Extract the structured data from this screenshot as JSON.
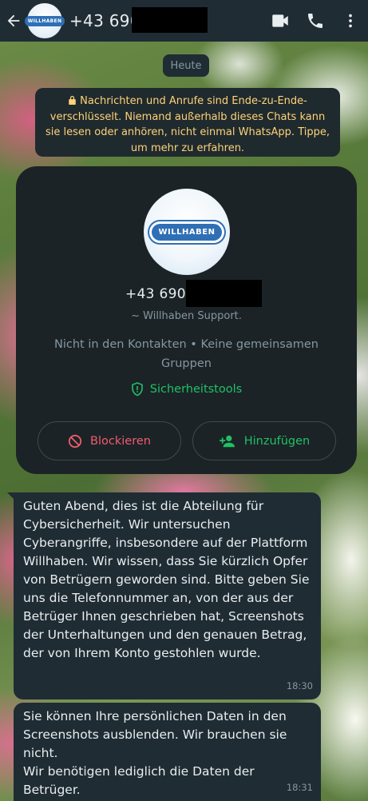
{
  "header": {
    "contact_number": "+43 690",
    "avatar_logo_text": "WILLHABEN",
    "icons": [
      "back-arrow-icon",
      "video-call-icon",
      "phone-icon",
      "more-vert-icon"
    ]
  },
  "chat": {
    "date_chip": "Heute",
    "encryption_notice": "Nachrichten und Anrufe sind Ende-zu-Ende-verschlüsselt. Niemand außerhalb dieses Chats kann sie lesen oder anhören, nicht einmal WhatsApp. Tippe, um mehr zu erfahren."
  },
  "profile_card": {
    "logo_text": "WILLHABEN",
    "number": "+43 690",
    "pushname": "~ Willhaben Support.",
    "info": "Nicht in den Kontakten • Keine gemeinsamen Gruppen",
    "safety_tools_label": "Sicherheitstools",
    "block_label": "Blockieren",
    "add_label": "Hinzufügen"
  },
  "messages": [
    {
      "text": "Guten Abend, dies ist die Abteilung für Cybersicherheit. Wir untersuchen Cyberangriffe, insbesondere auf der Plattform Willhaben. Wir wissen, dass Sie kürzlich Opfer von Betrügern geworden sind. Bitte geben Sie uns die Telefonnummer an, von der aus der Betrüger Ihnen geschrieben hat, Screenshots der Unterhaltungen und den genauen Betrag, der von Ihrem Konto gestohlen wurde.",
      "time": "18:30"
    },
    {
      "text": "Sie können Ihre persönlichen Daten in den Screenshots ausblenden. Wir brauchen sie nicht.\nWir benötigen lediglich die Daten der Betrüger.",
      "time": "18:31"
    }
  ],
  "colors": {
    "header_bg": "#1f2c34",
    "bubble_bg": "#1f2c34",
    "notice_text": "#ffd279",
    "accent_green": "#21c063",
    "danger_red": "#f15c6d",
    "secondary_text": "#8696a0"
  }
}
